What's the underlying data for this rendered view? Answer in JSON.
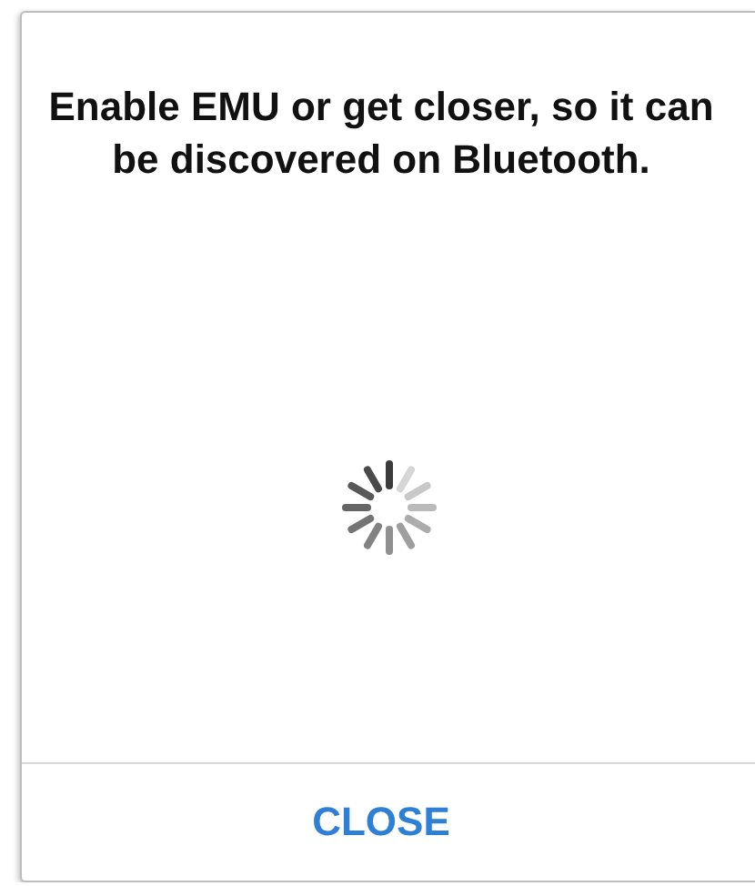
{
  "dialog": {
    "message": "Enable EMU or get closer, so it can be discovered on Bluetooth.",
    "buttons": [
      "CLOSE"
    ]
  }
}
